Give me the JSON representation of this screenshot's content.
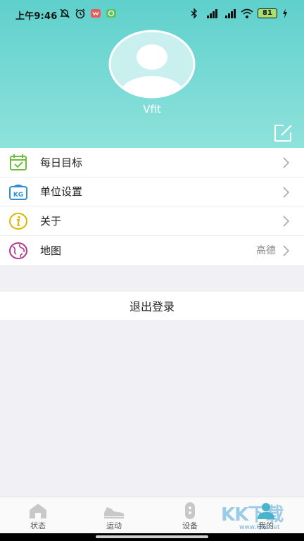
{
  "status_bar": {
    "time": "上午9:46",
    "battery": "81"
  },
  "profile": {
    "nickname": "Vfit"
  },
  "menu": {
    "items": [
      {
        "label": "每日目标",
        "value": "",
        "icon": "calendar-check-icon"
      },
      {
        "label": "单位设置",
        "value": "",
        "icon": "kg-scale-icon"
      },
      {
        "label": "关于",
        "value": "",
        "icon": "info-icon"
      },
      {
        "label": "地图",
        "value": "高德",
        "icon": "globe-icon"
      }
    ]
  },
  "logout_label": "退出登录",
  "tabs": [
    {
      "label": "状态",
      "icon": "home-icon"
    },
    {
      "label": "运动",
      "icon": "shoe-icon"
    },
    {
      "label": "设备",
      "icon": "band-icon"
    },
    {
      "label": "我的",
      "icon": "person-icon"
    }
  ],
  "watermark": {
    "text": "KK下载",
    "url": "www.kkx.net"
  },
  "colors": {
    "header_top": "#5fd0cc",
    "header_bottom": "#8fe2dc",
    "background": "#f1f1f5"
  }
}
